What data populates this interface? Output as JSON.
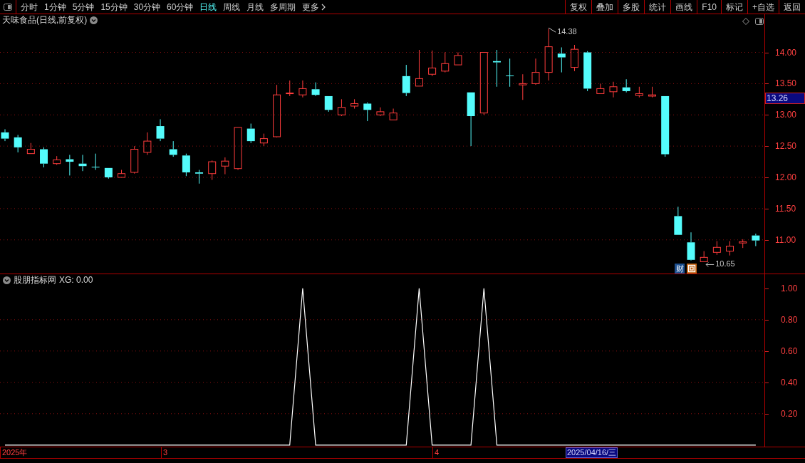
{
  "toolbar": {
    "periods": [
      {
        "label": "分时",
        "selected": false
      },
      {
        "label": "1分钟",
        "selected": false
      },
      {
        "label": "5分钟",
        "selected": false
      },
      {
        "label": "15分钟",
        "selected": false
      },
      {
        "label": "30分钟",
        "selected": false
      },
      {
        "label": "60分钟",
        "selected": false
      },
      {
        "label": "日线",
        "selected": true
      },
      {
        "label": "周线",
        "selected": false
      },
      {
        "label": "月线",
        "selected": false
      },
      {
        "label": "多周期",
        "selected": false
      }
    ],
    "more": "更多",
    "buttons": [
      "复权",
      "叠加",
      "多股",
      "统计",
      "画线",
      "F10",
      "标记",
      "+自选",
      "返回"
    ]
  },
  "main_chart": {
    "title": "天味食品(日线,前复权)",
    "last_price": "13.26",
    "high_label": "14.38",
    "low_label": "10.65",
    "badge": "财",
    "chart_data": {
      "type": "candlestick",
      "ylim": [
        10.45,
        14.61
      ],
      "grid": true,
      "yticks": [
        {
          "value": 11,
          "label": "11.00"
        },
        {
          "value": 11.5,
          "label": "11.50"
        },
        {
          "value": 12,
          "label": "12.00"
        },
        {
          "value": 12.5,
          "label": "12.50"
        },
        {
          "value": 13,
          "label": "13.00"
        },
        {
          "value": 13.5,
          "label": "13.50"
        },
        {
          "value": 14,
          "label": "14.00"
        }
      ],
      "ohlc": [
        [
          12.72,
          12.77,
          12.58,
          12.62
        ],
        [
          12.64,
          12.68,
          12.4,
          12.48
        ],
        [
          12.38,
          12.55,
          12.38,
          12.45
        ],
        [
          12.45,
          12.48,
          12.16,
          12.22
        ],
        [
          12.22,
          12.34,
          12.2,
          12.28
        ],
        [
          12.29,
          12.36,
          12.03,
          12.25
        ],
        [
          12.22,
          12.36,
          12.1,
          12.18
        ],
        [
          12.17,
          12.38,
          12.12,
          12.16
        ],
        [
          12.15,
          12.15,
          11.98,
          12.0
        ],
        [
          12.0,
          12.12,
          12.0,
          12.06
        ],
        [
          12.08,
          12.5,
          12.06,
          12.45
        ],
        [
          12.4,
          12.72,
          12.36,
          12.58
        ],
        [
          12.82,
          12.93,
          12.58,
          12.62
        ],
        [
          12.45,
          12.58,
          12.33,
          12.36
        ],
        [
          12.35,
          12.38,
          12.02,
          12.08
        ],
        [
          12.08,
          12.12,
          11.9,
          12.06
        ],
        [
          12.06,
          12.27,
          11.96,
          12.25
        ],
        [
          12.18,
          12.32,
          12.05,
          12.26
        ],
        [
          12.14,
          12.8,
          12.12,
          12.8
        ],
        [
          12.78,
          12.86,
          12.55,
          12.58
        ],
        [
          12.55,
          12.7,
          12.5,
          12.62
        ],
        [
          12.65,
          13.48,
          12.64,
          13.32
        ],
        [
          13.34,
          13.55,
          13.3,
          13.35
        ],
        [
          13.32,
          13.55,
          13.28,
          13.42
        ],
        [
          13.41,
          13.52,
          13.3,
          13.32
        ],
        [
          13.3,
          13.3,
          13.05,
          13.08
        ],
        [
          13.0,
          13.25,
          12.98,
          13.12
        ],
        [
          13.14,
          13.25,
          13.1,
          13.18
        ],
        [
          13.18,
          13.2,
          12.9,
          13.08
        ],
        [
          13.0,
          13.12,
          12.98,
          13.05
        ],
        [
          12.92,
          13.1,
          12.92,
          13.03
        ],
        [
          13.62,
          13.8,
          13.3,
          13.35
        ],
        [
          13.46,
          14.04,
          13.46,
          13.58
        ],
        [
          13.65,
          14.03,
          13.62,
          13.75
        ],
        [
          13.7,
          14.0,
          13.68,
          13.82
        ],
        [
          13.8,
          14.0,
          13.8,
          13.95
        ],
        [
          13.36,
          13.36,
          12.5,
          12.98
        ],
        [
          13.03,
          14.0,
          13.0,
          14.0
        ],
        [
          13.86,
          14.04,
          13.45,
          13.84
        ],
        [
          13.63,
          13.9,
          13.45,
          13.62
        ],
        [
          13.48,
          13.65,
          13.24,
          13.5
        ],
        [
          13.5,
          13.9,
          13.48,
          13.68
        ],
        [
          13.68,
          14.38,
          13.55,
          14.09
        ],
        [
          13.98,
          14.08,
          13.68,
          13.92
        ],
        [
          13.76,
          14.12,
          13.7,
          14.05
        ],
        [
          14.0,
          14.02,
          13.38,
          13.42
        ],
        [
          13.34,
          13.5,
          13.34,
          13.42
        ],
        [
          13.37,
          13.53,
          13.28,
          13.45
        ],
        [
          13.44,
          13.57,
          13.36,
          13.38
        ],
        [
          13.31,
          13.45,
          13.28,
          13.34
        ],
        [
          13.3,
          13.45,
          13.28,
          13.32
        ],
        [
          13.3,
          13.3,
          12.33,
          12.37
        ],
        [
          11.38,
          11.53,
          11.08,
          11.08
        ],
        [
          10.96,
          11.12,
          10.67,
          10.68
        ],
        [
          10.65,
          10.82,
          10.65,
          10.72
        ],
        [
          10.8,
          10.98,
          10.76,
          10.88
        ],
        [
          10.82,
          10.98,
          10.75,
          10.9
        ],
        [
          10.95,
          11.01,
          10.87,
          10.97
        ],
        [
          11.07,
          11.1,
          10.9,
          10.99
        ]
      ]
    }
  },
  "indicator": {
    "name": "股朋指标网",
    "reading": "XG: 0.00",
    "chart_data": {
      "type": "line",
      "ylim": [
        -0.01,
        1.09
      ],
      "grid": true,
      "yticks": [
        {
          "value": 0.2,
          "label": "0.20"
        },
        {
          "value": 0.4,
          "label": "0.40"
        },
        {
          "value": 0.6,
          "label": "0.60"
        },
        {
          "value": 0.8,
          "label": "0.80"
        },
        {
          "value": 1,
          "label": "1.00"
        }
      ],
      "series": [
        {
          "color": "#ffffff",
          "values": [
            0,
            0,
            0,
            0,
            0,
            0,
            0,
            0,
            0,
            0,
            0,
            0,
            0,
            0,
            0,
            0,
            0,
            0,
            0,
            0,
            0,
            0,
            0,
            1,
            0,
            0,
            0,
            0,
            0,
            0,
            0,
            0,
            1,
            0,
            0,
            0,
            0,
            1,
            0,
            0,
            0,
            0,
            0,
            0,
            0,
            0,
            0,
            0,
            0,
            0,
            0,
            0,
            0,
            0,
            0,
            0,
            0,
            0,
            0
          ]
        }
      ]
    }
  },
  "date_axis": {
    "labels": [
      "2025年",
      "3",
      "4"
    ],
    "cursor_date": "2025/04/16/三"
  }
}
